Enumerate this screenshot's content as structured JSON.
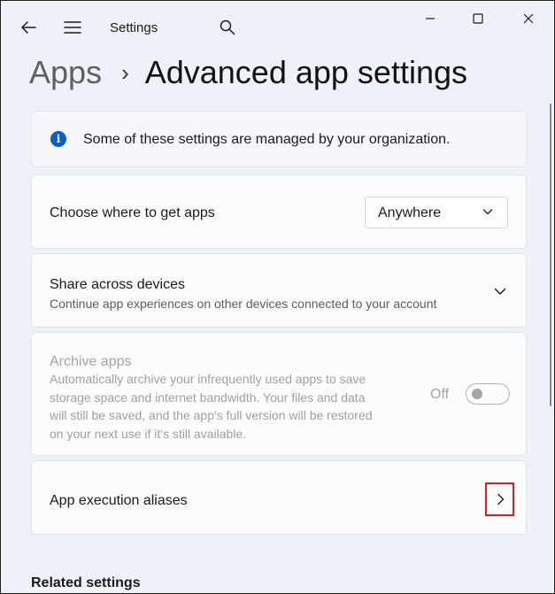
{
  "window": {
    "title": "Settings"
  },
  "breadcrumb": {
    "parent": "Apps",
    "separator": "›",
    "current": "Advanced app settings"
  },
  "info": {
    "text": "Some of these settings are managed by your organization."
  },
  "choose_apps": {
    "label": "Choose where to get apps",
    "selected": "Anywhere"
  },
  "share": {
    "title": "Share across devices",
    "subtitle": "Continue app experiences on other devices connected to your account"
  },
  "archive": {
    "title": "Archive apps",
    "desc_lines": [
      "Automatically archive your infrequently used apps to save",
      "storage space and internet bandwidth. Your files and data",
      "will still be saved, and the app's full version will be restored",
      "on your next use if it's still available."
    ],
    "toggle_label": "Off",
    "toggle_state": false,
    "enabled": false
  },
  "aliases": {
    "label": "App execution aliases"
  },
  "related": {
    "header": "Related settings"
  },
  "colors": {
    "accent": "#0a5fc4",
    "highlight": "#d2202a"
  },
  "icons": [
    "back-arrow-icon",
    "hamburger-menu-icon",
    "search-icon",
    "minimize-icon",
    "maximize-icon",
    "close-icon",
    "info-icon",
    "chevron-down-icon",
    "chevron-right-icon"
  ]
}
